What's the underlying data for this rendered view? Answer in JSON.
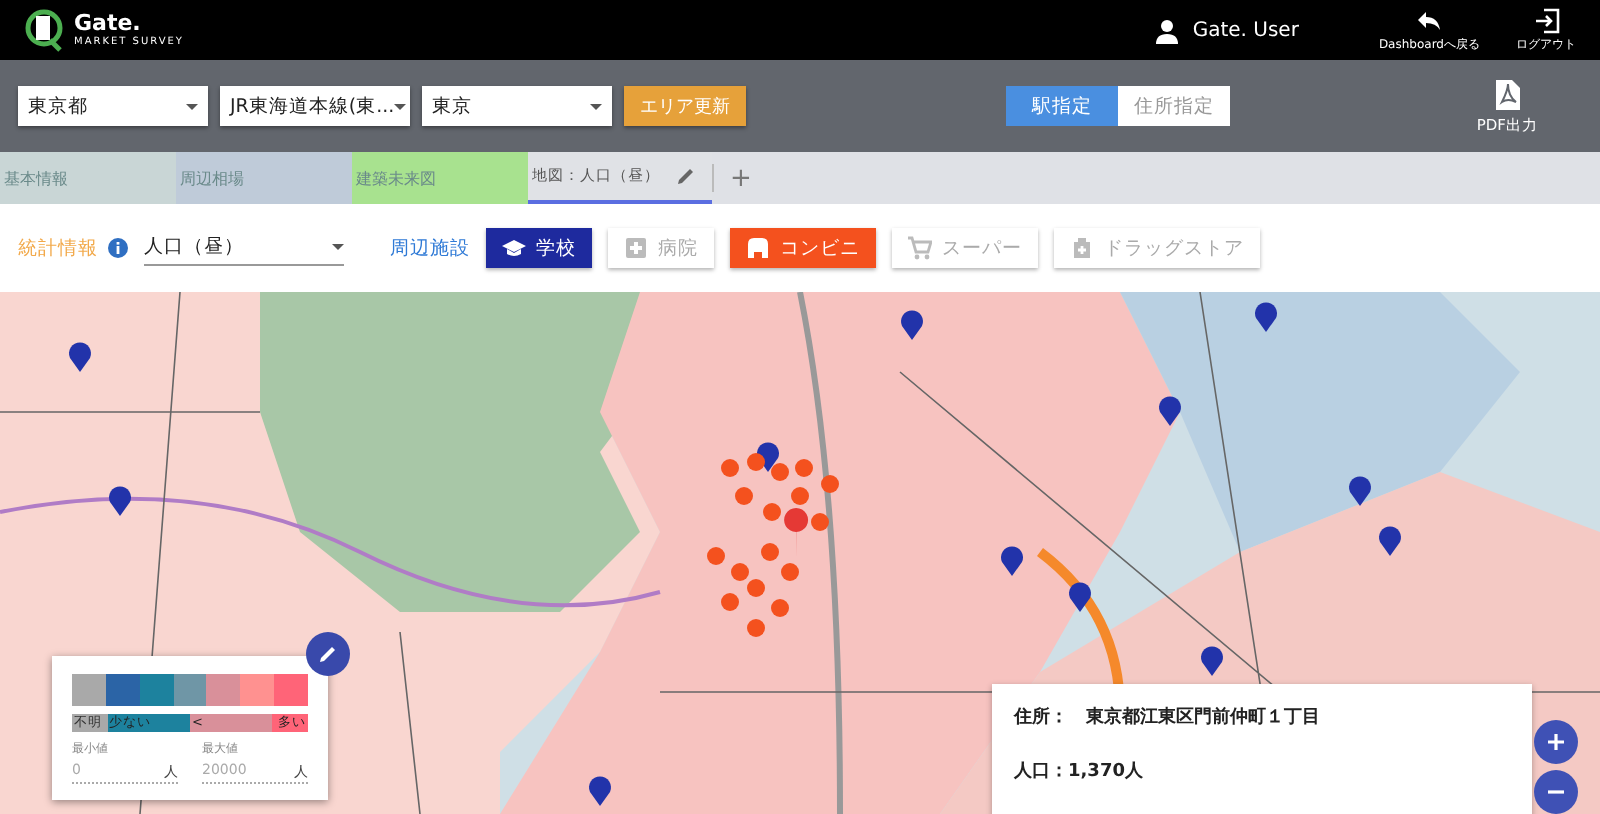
{
  "header": {
    "logo_title": "Gate.",
    "logo_subtitle": "MARKET SURVEY",
    "user": "Gate. User",
    "actions": [
      {
        "kind": "back",
        "label": "Dashboardへ戻る"
      },
      {
        "kind": "logout",
        "label": "ログアウト"
      }
    ]
  },
  "toolbar": {
    "selects": [
      {
        "value": "東京都"
      },
      {
        "value": "JR東海道本線(東..."
      },
      {
        "value": "東京"
      }
    ],
    "update_button": "エリア更新",
    "modes": [
      {
        "label": "駅指定",
        "selected": true
      },
      {
        "label": "住所指定",
        "selected": false
      }
    ],
    "pdf_button": "PDF出力"
  },
  "tabs": [
    {
      "label": "基本情報",
      "selected": false,
      "color": "#c9d6d6"
    },
    {
      "label": "周辺相場",
      "selected": false,
      "color": "#bfcbd9"
    },
    {
      "label": "建築未来図",
      "selected": false,
      "color": "#a8e28f"
    },
    {
      "label": "地図：人口（昼）",
      "selected": true,
      "color": "#e0e2e6"
    }
  ],
  "add_tab": "+",
  "filters": {
    "stats_label": "統計情報",
    "stats_value": "人口（昼）",
    "facilities_label": "周辺施設",
    "facilities": [
      {
        "kind": "school",
        "label": "学校",
        "selected": true,
        "color": "#1e2a9e"
      },
      {
        "kind": "hospital",
        "label": "病院",
        "selected": false
      },
      {
        "kind": "store",
        "label": "コンビニ",
        "selected": true,
        "color": "#f4511e"
      },
      {
        "kind": "cart",
        "label": "スーパー",
        "selected": false
      },
      {
        "kind": "drug",
        "label": "ドラッグストア",
        "selected": false
      }
    ]
  },
  "legend": {
    "swatches": [
      {
        "color": "#a9a9a9"
      },
      {
        "color": "#2b64a6"
      },
      {
        "color": "#1d829e"
      },
      {
        "color": "#6f96a6"
      },
      {
        "color": "#d9909a"
      },
      {
        "color": "#ff9190"
      },
      {
        "color": "#ff6478"
      }
    ],
    "labels": [
      "不明",
      "少ない",
      "<",
      "多い"
    ],
    "min_label": "最小値",
    "min_value": "0",
    "min_unit": "人",
    "max_label": "最大値",
    "max_value": "20000",
    "max_unit": "人"
  },
  "info": {
    "address_label": "住所：",
    "address": "東京都江東区門前仲町１丁目",
    "population": "人口：1,370人"
  }
}
